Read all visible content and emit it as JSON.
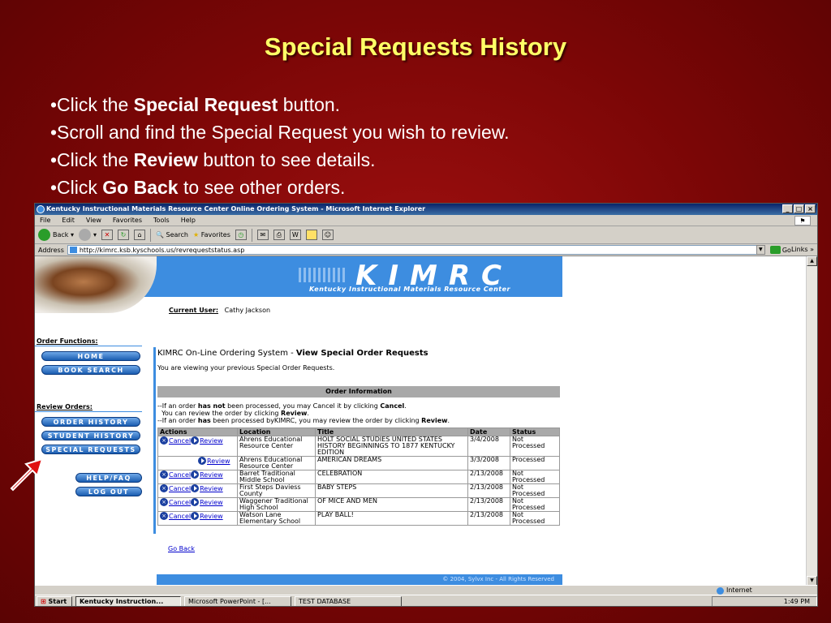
{
  "slide": {
    "title": "Special Requests History",
    "bullets": [
      {
        "prefix": "•Click the ",
        "bold": "Special Request",
        "suffix": " button."
      },
      {
        "prefix": "•Scroll and find the Special Request you wish to review.",
        "bold": "",
        "suffix": ""
      },
      {
        "prefix": "•Click the ",
        "bold": "Review",
        "suffix": " button to see details."
      },
      {
        "prefix": "•Click ",
        "bold": "Go Back",
        "suffix": " to see other orders."
      }
    ]
  },
  "browser": {
    "title": "Kentucky Instructional Materials Resource Center Online Ordering System - Microsoft Internet Explorer",
    "menu": [
      "File",
      "Edit",
      "View",
      "Favorites",
      "Tools",
      "Help"
    ],
    "toolbar": {
      "back": "Back",
      "search": "Search",
      "favorites": "Favorites"
    },
    "address_label": "Address",
    "address": "http://kimrc.ksb.kyschools.us/revrequeststatus.asp",
    "go": "Go",
    "links": "Links",
    "links_chevron": "»",
    "status_zone": "Internet"
  },
  "page": {
    "logo": "KIMRC",
    "logo_sub": "Kentucky Instructional Materials Resource Center",
    "current_user_label": "Current User:",
    "current_user": "Cathy Jackson",
    "order_functions_label": "Order Functions:",
    "order_functions": [
      "HOME",
      "BOOK SEARCH"
    ],
    "review_orders_label": "Review Orders:",
    "review_orders": [
      "ORDER HISTORY",
      "STUDENT HISTORY",
      "SPECIAL REQUESTS"
    ],
    "extra_buttons": [
      "HELP/FAQ",
      "LOG OUT"
    ],
    "system_title_prefix": "KIMRC On-Line Ordering System - ",
    "system_title_bold": "View Special Order Requests",
    "viewing_text": "You are viewing your previous Special Order Requests.",
    "order_info_label": "Order Information",
    "note_lines": [
      {
        "a": "--If an order ",
        "b": "has not",
        "c": " been processed, you may Cancel it by clicking ",
        "d": "Cancel",
        "e": "."
      },
      {
        "a": "  You can review the order by clicking ",
        "b": "Review",
        "c": ".",
        "d": "",
        "e": ""
      },
      {
        "a": "--If an order ",
        "b": "has",
        "c": " been processed byKIMRC, you may review the order by clicking ",
        "d": "Review",
        "e": "."
      }
    ],
    "table_headers": [
      "Actions",
      "Location",
      "Title",
      "Date",
      "Status"
    ],
    "cancel_label": "Cancel",
    "review_label": "Review",
    "rows": [
      {
        "cancel": true,
        "location": "Ahrens Educational Resource Center",
        "title": "HOLT SOCIAL STUDIES UNITED STATES HISTORY BEGINNINGS TO 1877 KENTUCKY EDITION",
        "date": "3/4/2008",
        "status": "Not Processed"
      },
      {
        "cancel": false,
        "location": "Ahrens Educational Resource Center",
        "title": "AMERICAN DREAMS",
        "date": "3/3/2008",
        "status": "Processed"
      },
      {
        "cancel": true,
        "location": "Barret Traditional Middle School",
        "title": "CELEBRATION",
        "date": "2/13/2008",
        "status": "Not Processed"
      },
      {
        "cancel": true,
        "location": "First Steps Daviess County",
        "title": "BABY STEPS",
        "date": "2/13/2008",
        "status": "Not Processed"
      },
      {
        "cancel": true,
        "location": "Waggener Traditional High School",
        "title": "OF MICE AND MEN",
        "date": "2/13/2008",
        "status": "Not Processed"
      },
      {
        "cancel": true,
        "location": "Watson Lane Elementary School",
        "title": "PLAY BALL!",
        "date": "2/13/2008",
        "status": "Not Processed"
      }
    ],
    "go_back": "Go Back",
    "footer": "© 2004, Sylvx Inc - All Rights Reserved"
  },
  "taskbar": {
    "start": "Start",
    "items": [
      "Kentucky Instruction...",
      "Microsoft PowerPoint - [...",
      "TEST DATABASE"
    ],
    "clock": "1:49 PM"
  },
  "colors": {
    "slide_bg": "#7a0606",
    "title": "#ffff66",
    "kimrc_blue": "#3d8de0",
    "arrow": "#e01010"
  }
}
